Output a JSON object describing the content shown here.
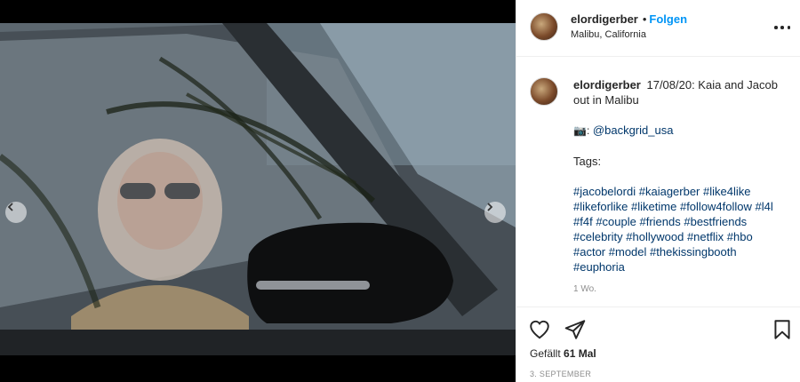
{
  "post": {
    "username": "elordigerber",
    "follow_label": "Folgen",
    "separator": "•",
    "location": "Malibu, California"
  },
  "caption": {
    "username": "elordigerber",
    "text": "17/08/20: Kaia and Jacob out in Malibu",
    "camera_emoji": "📷:",
    "credit": "@backgrid_usa",
    "tags_label": "Tags:",
    "hashtags": [
      "#jacobelordi",
      "#kaiagerber",
      "#like4like",
      "#likeforlike",
      "#liketime",
      "#follow4follow",
      "#l4l",
      "#f4f",
      "#couple",
      "#friends",
      "#bestfriends",
      "#celebrity",
      "#hollywood",
      "#netflix",
      "#hbo",
      "#actor",
      "#model",
      "#thekissingbooth",
      "#euphoria"
    ],
    "time_ago": "1 Wo."
  },
  "footer": {
    "likes_prefix": "Gefällt",
    "likes_count": "61 Mal",
    "date": "3. SEPTEMBER"
  },
  "carousel": {
    "slide_count": 7,
    "active_slide": 4
  },
  "icons": {
    "more": "more-options-icon",
    "like": "heart-icon",
    "share": "share-paper-plane-icon",
    "save": "bookmark-icon",
    "prev": "chevron-left-icon",
    "next": "chevron-right-icon"
  },
  "colors": {
    "link_blue": "#0095f6",
    "hashtag": "#00376b",
    "muted": "#8e8e8e"
  }
}
